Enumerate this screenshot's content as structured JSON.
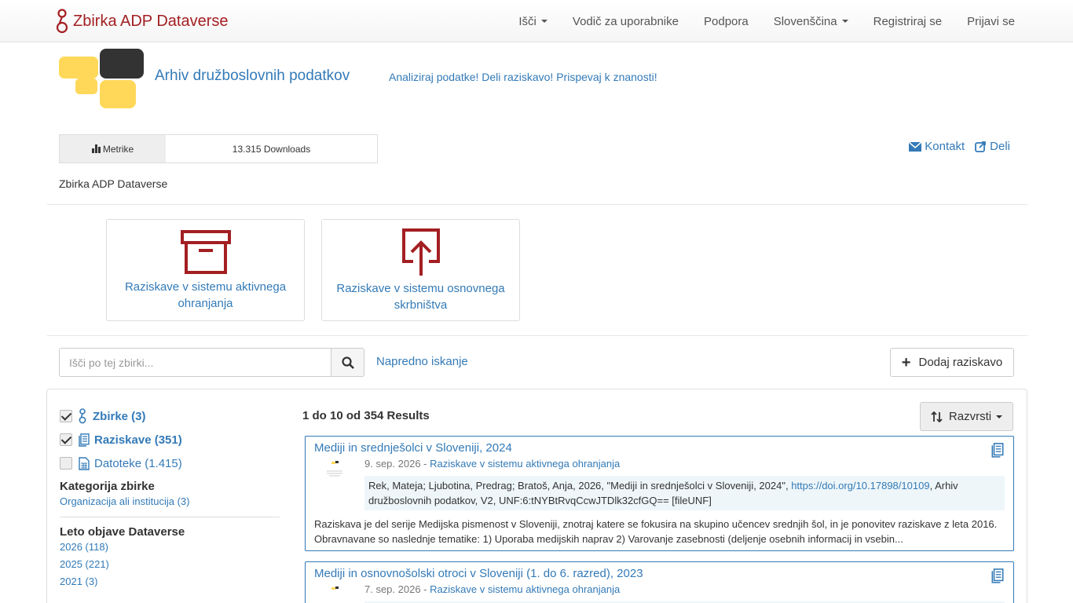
{
  "navbar": {
    "brand": "Zbirka ADP Dataverse",
    "items": [
      {
        "label": "Išči",
        "dropdown": true
      },
      {
        "label": "Vodič za uporabnike",
        "dropdown": false
      },
      {
        "label": "Podpora",
        "dropdown": false
      },
      {
        "label": "Slovenščina",
        "dropdown": true
      },
      {
        "label": "Registriraj se",
        "dropdown": false
      },
      {
        "label": "Prijavi se",
        "dropdown": false
      }
    ]
  },
  "header": {
    "title": "Arhiv družboslovnih podatkov",
    "tagline": "Analiziraj podatke! Deli raziskavo! Prispevaj k znanosti!"
  },
  "metrics": {
    "label": "Metrike",
    "value": "13.315 Downloads"
  },
  "actions": {
    "contact": "Kontakt",
    "share": "Deli"
  },
  "breadcrumb": "Zbirka ADP Dataverse",
  "cards": [
    {
      "label": "Raziskave v sistemu aktivnega ohranjanja"
    },
    {
      "label": "Raziskave v sistemu osnovnega skrbništva"
    }
  ],
  "search": {
    "placeholder": "Išči po tej zbirki...",
    "advanced": "Napredno iskanje",
    "add_button": "Dodaj raziskavo"
  },
  "facets": {
    "types": [
      {
        "label": "Zbirke (3)",
        "checked": true
      },
      {
        "label": "Raziskave (351)",
        "checked": true
      },
      {
        "label": "Datoteke (1.415)",
        "checked": false
      }
    ],
    "groups": [
      {
        "title": "Kategorija zbirke",
        "items": [
          "Organizacija ali institucija (3)"
        ]
      },
      {
        "title": "Leto objave Dataverse",
        "items": [
          "2026 (118)",
          "2025 (221)",
          "2021 (3)"
        ]
      }
    ]
  },
  "results": {
    "count": "1 do 10 od 354 Results",
    "sort_label": "Razvrsti",
    "items": [
      {
        "title": "Mediji in srednješolci v Sloveniji, 2024",
        "date": "9. sep. 2026",
        "collection": "Raziskave v sistemu aktivnega ohranjanja",
        "citation_pre": "Rek, Mateja; Ljubotina, Predrag; Bratoš, Anja, 2026, \"Mediji in srednješolci v Sloveniji, 2024\", ",
        "citation_doi": "https://doi.org/10.17898/10109",
        "citation_post": ", Arhiv družboslovnih podatkov, V2, UNF:6:tNYBtRvqCcwJTDlk32cfGQ== [fileUNF]",
        "description": "Raziskava je del serije Medijska pismenost v Sloveniji, znotraj katere se fokusira na skupino učencev srednjih šol, in je ponovitev raziskave z leta 2016. Obravnavane so naslednje tematike: 1) Uporaba medijskih naprav 2) Varovanje zasebnosti (deljenje osebnih informacij in vsebin..."
      },
      {
        "title": "Mediji in osnovnošolski otroci v Sloveniji (1. do 6. razred), 2023",
        "date": "7. sep. 2026",
        "collection": "Raziskave v sistemu aktivnega ohranjanja"
      }
    ]
  },
  "colors": {
    "brand": "#a31f22",
    "link": "#337ab7",
    "logo_yellow": "#ffd85a",
    "logo_dark": "#333333",
    "citation_bg": "#eef6f9"
  }
}
